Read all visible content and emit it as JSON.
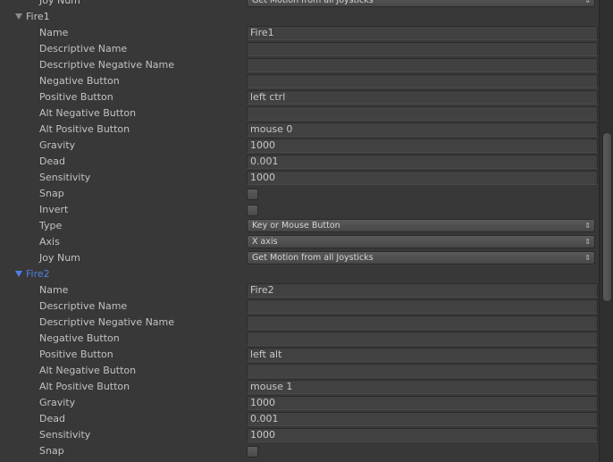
{
  "rows": [
    {
      "type": "dropdown",
      "label": "Joy Num",
      "value": "Get Motion from all Joysticks"
    },
    {
      "type": "header",
      "label": "Fire1",
      "selected": false
    },
    {
      "type": "text",
      "label": "Name",
      "value": "Fire1"
    },
    {
      "type": "text",
      "label": "Descriptive Name",
      "value": ""
    },
    {
      "type": "text",
      "label": "Descriptive Negative Name",
      "value": ""
    },
    {
      "type": "text",
      "label": "Negative Button",
      "value": ""
    },
    {
      "type": "text",
      "label": "Positive Button",
      "value": "left ctrl"
    },
    {
      "type": "text",
      "label": "Alt Negative Button",
      "value": ""
    },
    {
      "type": "text",
      "label": "Alt Positive Button",
      "value": "mouse 0"
    },
    {
      "type": "text",
      "label": "Gravity",
      "value": "1000"
    },
    {
      "type": "text",
      "label": "Dead",
      "value": "0.001"
    },
    {
      "type": "text",
      "label": "Sensitivity",
      "value": "1000"
    },
    {
      "type": "checkbox",
      "label": "Snap",
      "checked": false
    },
    {
      "type": "checkbox",
      "label": "Invert",
      "checked": false
    },
    {
      "type": "dropdown",
      "label": "Type",
      "value": "Key or Mouse Button"
    },
    {
      "type": "dropdown",
      "label": "Axis",
      "value": "X axis"
    },
    {
      "type": "dropdown",
      "label": "Joy Num",
      "value": "Get Motion from all Joysticks"
    },
    {
      "type": "header",
      "label": "Fire2",
      "selected": true
    },
    {
      "type": "text",
      "label": "Name",
      "value": "Fire2"
    },
    {
      "type": "text",
      "label": "Descriptive Name",
      "value": ""
    },
    {
      "type": "text",
      "label": "Descriptive Negative Name",
      "value": ""
    },
    {
      "type": "text",
      "label": "Negative Button",
      "value": ""
    },
    {
      "type": "text",
      "label": "Positive Button",
      "value": "left alt"
    },
    {
      "type": "text",
      "label": "Alt Negative Button",
      "value": ""
    },
    {
      "type": "text",
      "label": "Alt Positive Button",
      "value": "mouse 1"
    },
    {
      "type": "text",
      "label": "Gravity",
      "value": "1000"
    },
    {
      "type": "text",
      "label": "Dead",
      "value": "0.001"
    },
    {
      "type": "text",
      "label": "Sensitivity",
      "value": "1000"
    },
    {
      "type": "checkbox",
      "label": "Snap",
      "checked": false
    }
  ],
  "colors": {
    "selected_header": "#4f7fe6",
    "background": "#383838"
  },
  "scrollbar": {
    "position_fraction": 0.45
  }
}
